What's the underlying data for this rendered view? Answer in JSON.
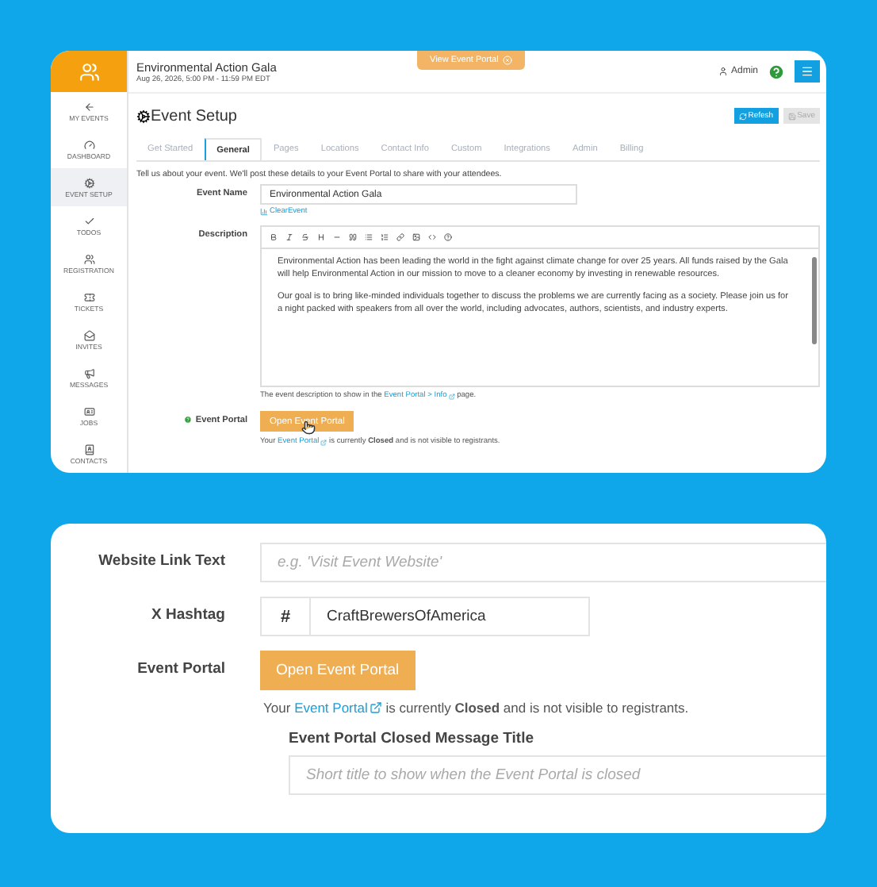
{
  "header": {
    "event_title": "Environmental Action Gala",
    "event_date": "Aug 26, 2026, 5:00 PM - 11:59 PM EDT",
    "portal_button": "View Event Portal",
    "user": "Admin"
  },
  "sidebar": {
    "items": [
      {
        "label": "MY EVENTS",
        "selected": false
      },
      {
        "label": "DASHBOARD",
        "selected": false
      },
      {
        "label": "EVENT SETUP",
        "selected": true
      },
      {
        "label": "TODOS",
        "selected": false
      },
      {
        "label": "REGISTRATION",
        "selected": false
      },
      {
        "label": "TICKETS",
        "selected": false
      },
      {
        "label": "INVITES",
        "selected": false
      },
      {
        "label": "MESSAGES",
        "selected": false
      },
      {
        "label": "JOBS",
        "selected": false
      },
      {
        "label": "CONTACTS",
        "selected": false
      }
    ]
  },
  "page": {
    "title": "Event Setup",
    "buttons": [
      {
        "label": "Refesh",
        "disabled": false
      },
      {
        "label": "Save",
        "disabled": true
      }
    ]
  },
  "tabs": [
    {
      "label": "Get Started",
      "selected": false
    },
    {
      "label": "General",
      "selected": true
    },
    {
      "label": "Pages",
      "selected": false
    },
    {
      "label": "Locations",
      "selected": false
    },
    {
      "label": "Contact Info",
      "selected": false
    },
    {
      "label": "Custom",
      "selected": false
    },
    {
      "label": "Integrations",
      "selected": false
    },
    {
      "label": "Admin",
      "selected": false
    },
    {
      "label": "Billing",
      "selected": false
    }
  ],
  "intro": "Tell us about your event. We'll post these details to your Event Portal to share with your attendees.",
  "event_name": {
    "label": "Event Name",
    "value": "Environmental Action Gala",
    "link": "ClearEvent"
  },
  "description": {
    "label": "Description",
    "paragraphs": [
      "Environmental Action has been leading the world in the fight against climate change for over 25 years. All funds raised by the Gala will help Environmental Action in our mission to move to a cleaner economy by investing in renewable resources.",
      "Our goal is to bring like-minded individuals together to discuss the problems we are currently facing as a society. Please join us for a night packed with speakers from all over the world, including advocates, authors, scientists, and industry experts."
    ],
    "hint": {
      "before": "The event description to show in the",
      "link": "Event Portal > Info",
      "after": "page."
    }
  },
  "event_portal": {
    "label": "Event Portal",
    "button": "Open Event Portal",
    "note": {
      "before": "Your",
      "link": "Event Portal",
      "after": "is currently **Closed** and is not visible to registrants."
    }
  },
  "detail_panel": {
    "fields": [
      {
        "kind": "text",
        "label": "Website Link Text",
        "placeholder": "e.g. 'Visit Event Website'"
      },
      {
        "kind": "addon",
        "label": "X Hashtag",
        "addon": "#",
        "value": "CraftBrewersOfAmerica"
      },
      {
        "kind": "portal",
        "label": "Event Portal",
        "button": "Open Event Portal",
        "note": {
          "before": "Your",
          "link": "Event Portal",
          "after": "is currently **Closed** and is not visible to registrants."
        }
      },
      {
        "kind": "stacked",
        "label": "Event Portal Closed Message Title",
        "placeholder": "Short title to show when the Event Portal is closed"
      }
    ]
  }
}
